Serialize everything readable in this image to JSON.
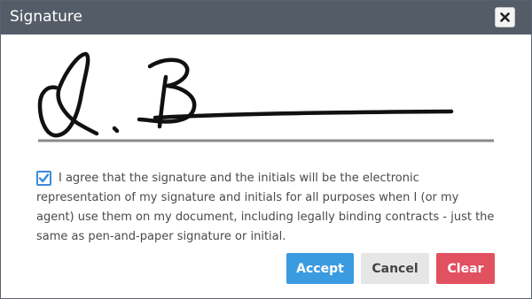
{
  "dialog": {
    "title": "Signature",
    "close_icon": "close-icon"
  },
  "signature": {
    "handwritten_text": "R. B"
  },
  "agreement": {
    "checked": true,
    "text": "I agree that the signature and the initials will be the electronic representation of my signature and initials for all purposes when I (or my agent) use them on my document, including legally binding contracts - just the same as pen-and-paper signature or initial."
  },
  "buttons": {
    "accept": "Accept",
    "cancel": "Cancel",
    "clear": "Clear"
  },
  "colors": {
    "titlebar": "#545c68",
    "accept": "#3b9be0",
    "cancel": "#e6e6e6",
    "clear": "#e15160",
    "checkbox": "#3d8ad8"
  }
}
